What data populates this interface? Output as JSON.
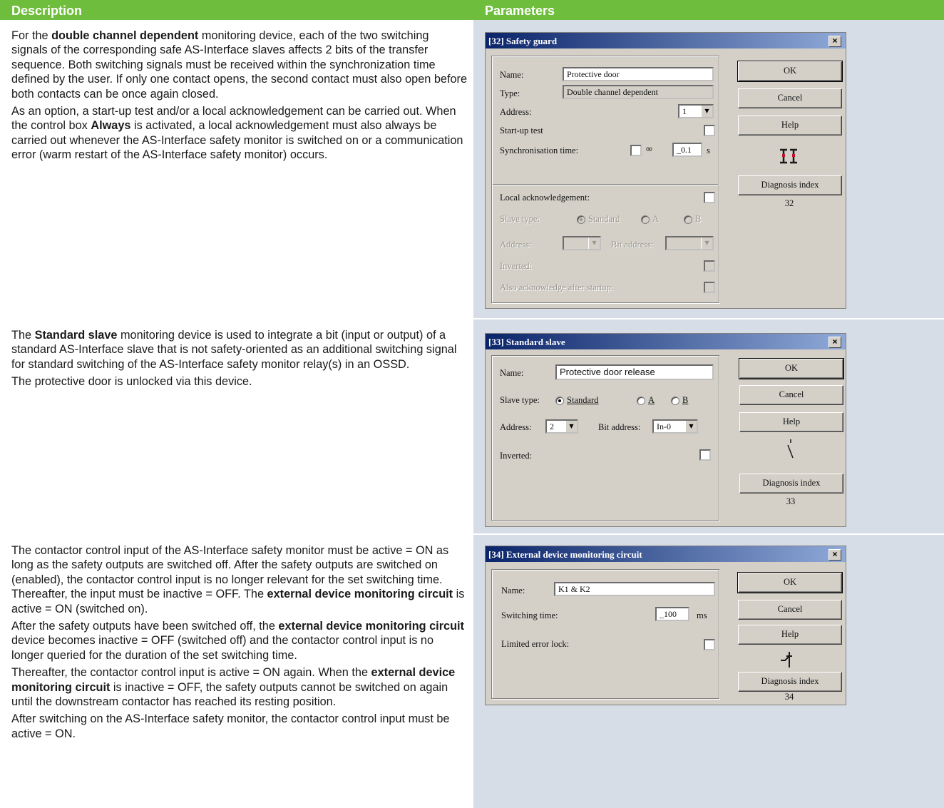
{
  "header": {
    "description": "Description",
    "parameters": "Parameters"
  },
  "section1": {
    "p1": [
      {
        "t": "For the ",
        "b": false
      },
      {
        "t": "double channel dependent",
        "b": true
      },
      {
        "t": " monitoring device, each of the two switching signals of the corresponding safe AS-Interface slaves affects 2 bits of the transfer sequence. Both switching signals must be received within the synchronization time defined by the user. If only one contact opens, the second contact must also open before both contacts can be once again closed.",
        "b": false
      }
    ],
    "p2": [
      {
        "t": "As an option, a start-up test and/or a local acknowledgement can be carried out. When the control box ",
        "b": false
      },
      {
        "t": "Always",
        "b": true
      },
      {
        "t": " is activated, a local acknowledgement must also always be carried out whenever the AS-Interface safety monitor is switched on or a communication error (warm restart of the AS-Interface safety monitor) occurs.",
        "b": false
      }
    ]
  },
  "section2": {
    "p1": [
      {
        "t": "The ",
        "b": false
      },
      {
        "t": "Standard slave",
        "b": true
      },
      {
        "t": " monitoring device is used to integrate a bit (input or output) of a standard AS-Interface slave that is not safety-oriented as an additional switching signal for standard switching of the AS-Interface safety monitor relay(s) in an OSSD.",
        "b": false
      }
    ],
    "p2": [
      {
        "t": "The protective door is unlocked via this device.",
        "b": false
      }
    ]
  },
  "section3": {
    "p1": [
      {
        "t": "The contactor control input of the AS-Interface safety monitor must be active = ON as long as the safety outputs are switched off. After the safety outputs are switched on (enabled), the contactor control input is no longer relevant for the set switching time. Thereafter, the input must be inactive = OFF. The ",
        "b": false
      },
      {
        "t": "external device monitoring circuit",
        "b": true
      },
      {
        "t": " is active = ON (switched on).",
        "b": false
      }
    ],
    "p2": [
      {
        "t": "After the safety outputs have been switched off, the ",
        "b": false
      },
      {
        "t": "external device monitoring circuit",
        "b": true
      },
      {
        "t": " device becomes inactive = OFF (switched off) and the contactor control input is no longer queried for the duration of the set switching time.",
        "b": false
      }
    ],
    "p3": [
      {
        "t": "Thereafter, the contactor control input is active = ON again. When the ",
        "b": false
      },
      {
        "t": "external device monitoring circuit",
        "b": true
      },
      {
        "t": " is inactive = OFF, the safety outputs cannot be switched on again until the downstream contactor has reached its resting position.",
        "b": false
      }
    ],
    "p4": [
      {
        "t": "After switching on the AS-Interface safety monitor, the contactor control input must be active = ON.",
        "b": false
      }
    ]
  },
  "dialog1": {
    "title": "[32] Safety guard",
    "close": "×",
    "name_label": "Name:",
    "name_value": "Protective door",
    "type_label": "Type:",
    "type_value": "Double channel dependent",
    "address_label": "Address:",
    "address_value": "1",
    "startup_label": "Start-up test",
    "sync_label": "Synchronisation time:",
    "sync_inf": "∞",
    "sync_value": "_0.1",
    "sync_unit": "s",
    "local_ack_label": "Local acknowledgement:",
    "slave_type_label": "Slave type:",
    "radio_standard": "Standard",
    "radio_a": "A",
    "radio_b": "B",
    "address2_label": "Address:",
    "bit_address_label": "Bit address:",
    "inverted_label": "Inverted:",
    "also_ack_label": "Also acknowledge after startup:",
    "ok": "OK",
    "cancel": "Cancel",
    "help": "Help",
    "diag": "Diagnosis index",
    "diag_num": "32",
    "icon": "double-channel-contact-icon"
  },
  "dialog2": {
    "title": "[33] Standard slave",
    "close": "×",
    "name_label": "Name:",
    "name_value": "Protective door release",
    "slave_type_label": "Slave type:",
    "radio_standard": "Standard",
    "radio_a": "A",
    "radio_b": "B",
    "address_label": "Address:",
    "address_value": "2",
    "bit_address_label": "Bit address:",
    "bit_address_value": "In-0",
    "inverted_label": "Inverted:",
    "ok": "OK",
    "cancel": "Cancel",
    "help": "Help",
    "diag": "Diagnosis index",
    "diag_num": "33",
    "icon": "switch-contact-icon"
  },
  "dialog3": {
    "title": "[34] External device monitoring circuit",
    "close": "×",
    "name_label": "Name:",
    "name_value": "K1 & K2",
    "switching_label": "Switching time:",
    "switching_value": "_100",
    "switching_unit": "ms",
    "limited_label": "Limited error lock:",
    "ok": "OK",
    "cancel": "Cancel",
    "help": "Help",
    "diag": "Diagnosis index",
    "diag_num": "34",
    "icon": "contactor-feedback-icon"
  },
  "colors": {
    "header": "#6fbd3c",
    "param_bg": "#d6dde6",
    "dialog_face": "#d4d0c8",
    "title_bar": "#0a246a"
  }
}
